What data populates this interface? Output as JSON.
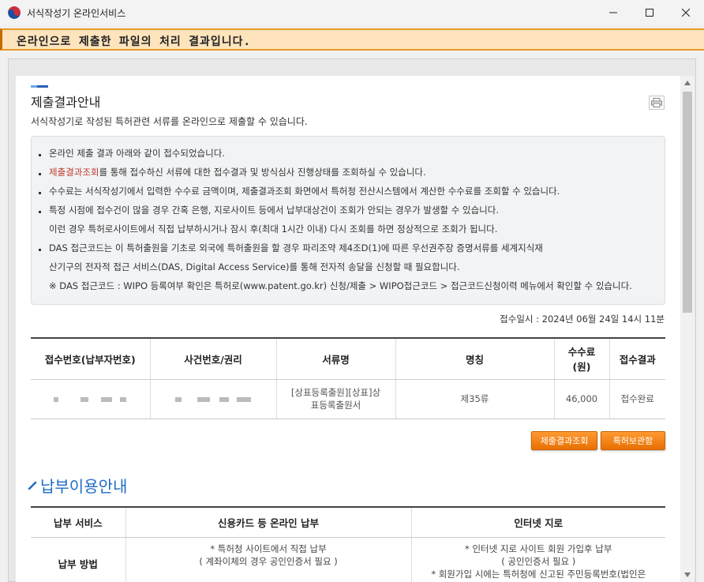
{
  "window": {
    "title": "서식작성기 온라인서비스",
    "minimize_icon": "minimize-icon",
    "maximize_icon": "maximize-icon",
    "close_icon": "close-icon"
  },
  "banner": {
    "text": "온라인으로 제출한 파일의 처리 결과입니다."
  },
  "section": {
    "title": "제출결과안내",
    "description": "서식작성기로 작성된 특허관련 서류를 온라인으로 제출할 수 있습니다."
  },
  "info": {
    "line1": "온라인 제출 결과 아래와 같이 접수되었습니다.",
    "line2_link": "제출결과조회",
    "line2_rest": "를 통해 접수하신 서류에 대한 접수결과 및 방식심사 진행상태를 조회하실 수 있습니다.",
    "line3": "수수료는 서식작성기에서 입력한 수수료 금액이며, 제출결과조회 화면에서 특허청 전산시스템에서 계산한 수수료를 조회할 수 있습니다.",
    "line4": "특정 시점에 접수건이 많을 경우 간혹 은행, 지로사이트 등에서 납부대상건이 조회가 안되는 경우가 발생할 수 있습니다.",
    "line5": "이런 경우 특허로사이트에서 직접 납부하시거나 잠시 후(최대 1시간 이내) 다시 조회를 하면 정상적으로 조회가 됩니다.",
    "line6": "DAS 접근코드는 이 특허출원을 기초로 외국에 특허출원을 할 경우 파리조약 제4조D(1)에 따른 우선권주장 증명서류를 세계지식재",
    "line7": "산기구의 전자적 접근 서비스(DAS, Digital Access Service)를 통해 전자적 송달을 신청할 때 필요합니다.",
    "line8": "※ DAS 접근코드 : WIPO 등록여부 확인은 특허로(www.patent.go.kr) 신청/제출 > WIPO접근코드 > 접근코드신청이력 메뉴에서 확인할 수 있습니다."
  },
  "receipt_time": "접수일시 : 2024년 06월 24일 14시 11분",
  "result_table": {
    "headers": [
      "접수번호(납부자번호)",
      "사건번호/권리",
      "서류명",
      "명칭",
      "수수료\n(원)",
      "접수결과"
    ],
    "header_fee_line1": "수수료",
    "header_fee_line2": "(원)",
    "row": {
      "doc_name": "[상표등록출원][상표]상표등록출원서",
      "doc_name_line1": "[상표등록출원][상표]상",
      "doc_name_line2": "표등록출원서",
      "title": "제35류",
      "fee": "46,000",
      "result": "접수완료"
    }
  },
  "buttons": {
    "submit_result": "제출결과조회",
    "patent_storage": "특허보관함"
  },
  "payment": {
    "title": "납부이용안내",
    "headers": [
      "납부 서비스",
      "신용카드 등 온라인 납부",
      "인터넷 지로"
    ],
    "row_head": "납부 방법",
    "online_line1": "* 특허청 사이트에서 직접 납부",
    "online_line2": "( 계좌이체의 경우 공인인증서 필요 )",
    "giro_line1": "* 인터넷 지로 사이트 회원 가입후 납부",
    "giro_line2": "( 공인인증서 필요 )",
    "giro_line3": "* 회원가입 시에는 특허청에 신고된 주민등록번호(법인은"
  },
  "colors": {
    "banner_bg": "#fde4bd",
    "accent_orange": "#e86f00",
    "link_red": "#c0392b",
    "title_blue": "#1f6bc5"
  },
  "icons": {
    "logo": "korea-taegeuk-logo-icon",
    "print": "print-icon",
    "pencil": "pencil-icon"
  }
}
